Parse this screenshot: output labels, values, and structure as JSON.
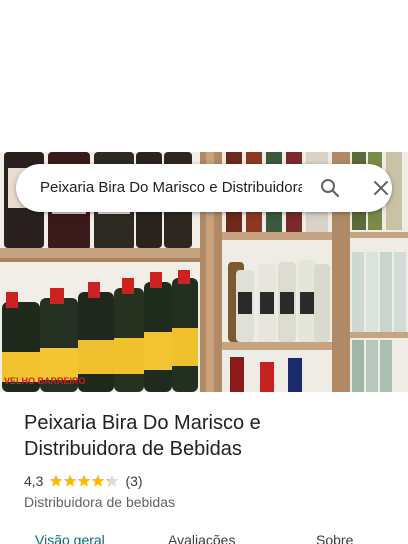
{
  "search": {
    "query": "Peixaria Bira Do Marisco e Distribuidora de Bebidas"
  },
  "place": {
    "name": "Peixaria Bira Do Marisco e Distribuidora de Bebidas",
    "rating": "4,3",
    "rating_value": 4.3,
    "rating_max": 5,
    "review_count": "(3)",
    "category": "Distribuidora de bebidas"
  },
  "photo": {
    "labels": [
      "VELHO BARREIRO"
    ]
  },
  "tabs": [
    {
      "label": "Visão geral",
      "active": true
    },
    {
      "label": "Avaliações",
      "active": false
    },
    {
      "label": "Sobre",
      "active": false
    }
  ],
  "colors": {
    "accent": "#0b6e74",
    "star": "#fbbc04",
    "shelf_wood": "#b08a66"
  },
  "icons": {
    "search": "search-icon",
    "close": "close-icon",
    "star": "star-icon"
  }
}
